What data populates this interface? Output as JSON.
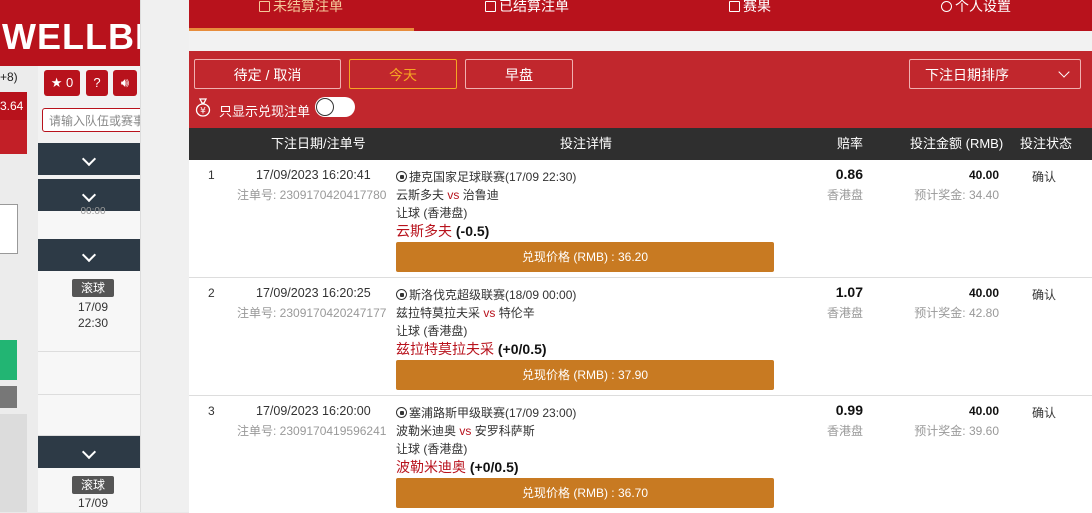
{
  "background_app": {
    "logo": "WELLBE",
    "odds_partial_top": "+8)",
    "odds_partial_red": "3.64",
    "favorites_count": "0",
    "help_icon_label": "?",
    "search_placeholder": "请输入队伍或赛事",
    "matches": [
      {
        "tag": "",
        "date": "",
        "time": "00:00"
      },
      {
        "tag": "滚球",
        "date": "17/09",
        "time": "22:30"
      },
      {
        "tag": "滚球",
        "date": "17/09",
        "time": ""
      }
    ]
  },
  "tabs": [
    {
      "label": "未结算注单",
      "icon": "edit-icon",
      "active": true
    },
    {
      "label": "已结算注单",
      "icon": "copy-icon",
      "active": false
    },
    {
      "label": "赛果",
      "icon": "scoreboard-icon",
      "active": false
    },
    {
      "label": "个人设置",
      "icon": "gear-icon",
      "active": false
    }
  ],
  "filters": {
    "buttons": [
      "待定 / 取消",
      "今天",
      "早盘"
    ],
    "active_button": "今天",
    "sort_label": "下注日期排序",
    "toggle_label": "只显示兑现注单",
    "toggle_on": false
  },
  "table": {
    "headers": {
      "date": "下注日期/注单号",
      "details": "投注详情",
      "odds": "赔率",
      "stake": "投注金额 (RMB)",
      "status": "投注状态"
    },
    "rows": [
      {
        "index": "1",
        "date": "17/09/2023 16:20:41",
        "ticket": "注单号: 2309170420417780",
        "league": "捷克国家足球联赛(17/09 22:30)",
        "home": "云斯多夫",
        "vs": "vs",
        "away": "治鲁迪",
        "market": "让球 (香港盘)",
        "pick_name": "云斯多夫",
        "pick_line": "(-0.5)",
        "cashout": "兑现价格 (RMB) : 36.20",
        "odds": "0.86",
        "odds_type": "香港盘",
        "stake": "40.00",
        "payout": "预计奖金: 34.40",
        "status": "确认"
      },
      {
        "index": "2",
        "date": "17/09/2023 16:20:25",
        "ticket": "注单号: 2309170420247177",
        "league": "斯洛伐克超级联赛(18/09 00:00)",
        "home": "兹拉特莫拉夫采",
        "vs": "vs",
        "away": "特伦辛",
        "market": "让球 (香港盘)",
        "pick_name": "兹拉特莫拉夫采",
        "pick_line": "(+0/0.5)",
        "cashout": "兑现价格 (RMB) : 37.90",
        "odds": "1.07",
        "odds_type": "香港盘",
        "stake": "40.00",
        "payout": "预计奖金: 42.80",
        "status": "确认"
      },
      {
        "index": "3",
        "date": "17/09/2023 16:20:00",
        "ticket": "注单号: 2309170419596241",
        "league": "塞浦路斯甲级联赛(17/09 23:00)",
        "home": "波勒米迪奥",
        "vs": "vs",
        "away": "安罗科萨斯",
        "market": "让球 (香港盘)",
        "pick_name": "波勒米迪奥",
        "pick_line": "(+0/0.5)",
        "cashout": "兑现价格 (RMB) : 36.70",
        "odds": "0.99",
        "odds_type": "香港盘",
        "stake": "40.00",
        "payout": "预计奖金: 39.60",
        "status": "确认"
      }
    ]
  },
  "colors": {
    "brand_red": "#b8121c",
    "filter_red": "#c1272d",
    "cashout_orange": "#c87a22",
    "active_orange": "#f5a623",
    "header_dark": "#2f2f2f"
  }
}
